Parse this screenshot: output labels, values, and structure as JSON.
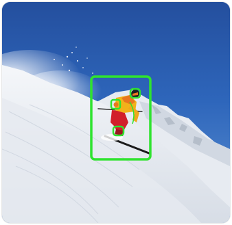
{
  "image": {
    "subject": "skier",
    "scene": "snowy-mountain-slope"
  },
  "colors": {
    "sky_top": "#2a5fb2",
    "sky_bottom": "#5b90d4",
    "snow": "#f3f5f8",
    "snow_shadow": "#c9d1de",
    "rock": "#5f6a78",
    "jacket_yellow": "#f2b21a",
    "jacket_orange": "#e9771f",
    "pants_red": "#d21f2a",
    "detection_box": "#2fe32f"
  },
  "overlays": {
    "detections": [
      {
        "name": "person-box",
        "color": "#2fe32f"
      },
      {
        "name": "head-box",
        "color": "#2fe32f"
      },
      {
        "name": "hand-box",
        "color": "#2fe32f"
      },
      {
        "name": "knee-box",
        "color": "#2fe32f"
      }
    ]
  }
}
